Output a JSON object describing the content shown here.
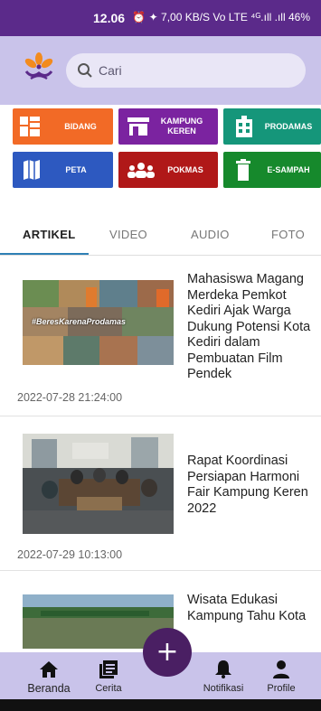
{
  "status_bar": {
    "time": "12.06",
    "icons_text": "⏰ ✦ 7,00 KB/S Vo LTE ⁴ᴳ.ıll .ıll 46%",
    "battery": "46%",
    "speed": "7,00 KB/S"
  },
  "header": {
    "search_placeholder": "Cari",
    "logo_icon": "flower-logo-icon"
  },
  "menu": [
    {
      "label": "BIDANG",
      "color": "#f26a26",
      "icon": "grid-blocks-icon"
    },
    {
      "label": "KAMPUNG\nKEREN",
      "line1": "KAMPUNG",
      "line2": "KEREN",
      "color": "#7b23a0",
      "icon": "store-icon"
    },
    {
      "label": "PRODAMAS",
      "color": "#15967a",
      "icon": "building-icon"
    },
    {
      "label": "PETA",
      "color": "#2d59c0",
      "icon": "map-icon"
    },
    {
      "label": "POKMAS",
      "color": "#b01818",
      "icon": "group-icon"
    },
    {
      "label": "E-SAMPAH",
      "color": "#16892c",
      "icon": "trash-icon"
    }
  ],
  "tabs": [
    {
      "label": "ARTIKEL",
      "active": true
    },
    {
      "label": "VIDEO",
      "active": false
    },
    {
      "label": "AUDIO",
      "active": false
    },
    {
      "label": "FOTO",
      "active": false
    }
  ],
  "articles": [
    {
      "title": "Mahasiswa Magang Merdeka Pemkot Kediri Ajak Warga Dukung Potensi Kota Kediri dalam Pembuatan Film Pendek",
      "date": "2022-07-28 21:24:00",
      "thumb_text": "#BeresKarenaProdamas"
    },
    {
      "title": "Rapat Koordinasi Persiapan Harmoni Fair Kampung Keren 2022",
      "date": "2022-07-29 10:13:00"
    },
    {
      "title": "Wisata Edukasi Kampung Tahu Kota"
    }
  ],
  "bottom_nav": [
    {
      "label": "Beranda",
      "icon": "home-icon"
    },
    {
      "label": "Cerita",
      "icon": "book-icon"
    },
    {
      "label": "Notifikasi",
      "icon": "bell-icon"
    },
    {
      "label": "Profile",
      "icon": "person-icon"
    }
  ],
  "fab": {
    "symbol": "+"
  },
  "colors": {
    "status_bar": "#5b2a8a",
    "header": "#c9c3ea",
    "fab": "#4a1f63",
    "tab_indicator": "#2f80b5"
  }
}
